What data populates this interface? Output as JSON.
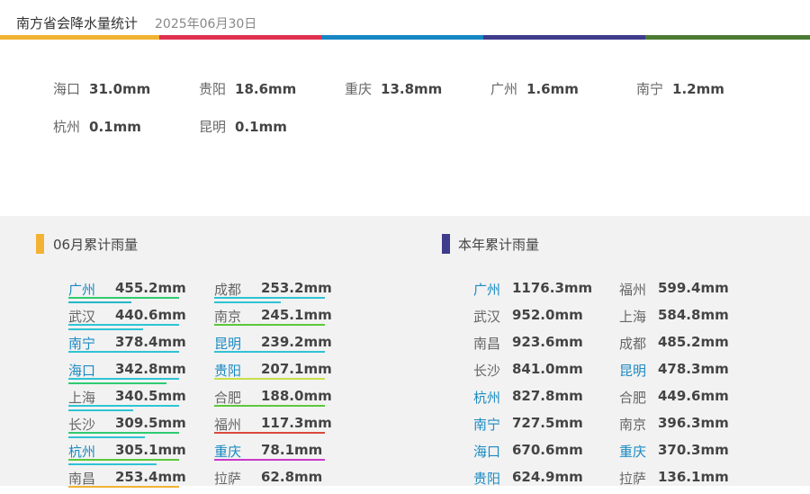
{
  "header": {
    "title": "南方省会降水量统计",
    "date": "2025年06月30日"
  },
  "colorbar": [
    "#f2b233",
    "#e0314f",
    "#1787c4",
    "#3f3c8c",
    "#4b7a33"
  ],
  "daily": [
    {
      "city": "海口",
      "value": "31.0mm"
    },
    {
      "city": "贵阳",
      "value": "18.6mm"
    },
    {
      "city": "重庆",
      "value": "13.8mm"
    },
    {
      "city": "广州",
      "value": "1.6mm"
    },
    {
      "city": "南宁",
      "value": "1.2mm"
    },
    {
      "city": "杭州",
      "value": "0.1mm"
    },
    {
      "city": "昆明",
      "value": "0.1mm"
    }
  ],
  "monthly": {
    "title": "06月累计雨量",
    "marker_color": "#f2b233",
    "items": [
      {
        "city": "广州",
        "value": "455.2mm",
        "highlight": true,
        "line_color": "#2ecc71",
        "line2_color": "#23b8c8"
      },
      {
        "city": "武汉",
        "value": "440.6mm",
        "highlight": false,
        "line_color": "#2fc3d4",
        "line2_color": "#2fc3d4"
      },
      {
        "city": "南宁",
        "value": "378.4mm",
        "highlight": true,
        "line_color": "#2fc3d4",
        "line2_color": ""
      },
      {
        "city": "海口",
        "value": "342.8mm",
        "highlight": true,
        "line_color": "#2fc3d4",
        "line2_color": "#2ecc71"
      },
      {
        "city": "上海",
        "value": "340.5mm",
        "highlight": false,
        "line_color": "#2fc3d4",
        "line2_color": "#2fc3d4"
      },
      {
        "city": "长沙",
        "value": "309.5mm",
        "highlight": false,
        "line_color": "#2ecc71",
        "line2_color": "#2fc3d4"
      },
      {
        "city": "杭州",
        "value": "305.1mm",
        "highlight": true,
        "line_color": "#5cc83a",
        "line2_color": "#2fc3d4"
      },
      {
        "city": "南昌",
        "value": "253.4mm",
        "highlight": false,
        "line_color": "#f2b233",
        "line2_color": ""
      },
      {
        "city": "成都",
        "value": "253.2mm",
        "highlight": false,
        "line_color": "#2fc3d4",
        "line2_color": "#2fc3d4"
      },
      {
        "city": "南京",
        "value": "245.1mm",
        "highlight": false,
        "line_color": "#5cc83a",
        "line2_color": ""
      },
      {
        "city": "昆明",
        "value": "239.2mm",
        "highlight": true,
        "line_color": "#2fc3d4",
        "line2_color": ""
      },
      {
        "city": "贵阳",
        "value": "207.1mm",
        "highlight": true,
        "line_color": "#c8e04a",
        "line2_color": ""
      },
      {
        "city": "合肥",
        "value": "188.0mm",
        "highlight": false,
        "line_color": "#5cc83a",
        "line2_color": ""
      },
      {
        "city": "福州",
        "value": "117.3mm",
        "highlight": false,
        "line_color": "#d94a3a",
        "line2_color": ""
      },
      {
        "city": "重庆",
        "value": "78.1mm",
        "highlight": true,
        "line_color": "#c83ac8",
        "line2_color": ""
      },
      {
        "city": "拉萨",
        "value": "62.8mm",
        "highlight": false,
        "line_color": "",
        "line2_color": ""
      }
    ]
  },
  "yearly": {
    "title": "本年累计雨量",
    "marker_color": "#3f3c8c",
    "items": [
      {
        "city": "广州",
        "value": "1176.3mm",
        "highlight": true
      },
      {
        "city": "武汉",
        "value": "952.0mm",
        "highlight": false
      },
      {
        "city": "南昌",
        "value": "923.6mm",
        "highlight": false
      },
      {
        "city": "长沙",
        "value": "841.0mm",
        "highlight": false
      },
      {
        "city": "杭州",
        "value": "827.8mm",
        "highlight": true
      },
      {
        "city": "南宁",
        "value": "727.5mm",
        "highlight": true
      },
      {
        "city": "海口",
        "value": "670.6mm",
        "highlight": true
      },
      {
        "city": "贵阳",
        "value": "624.9mm",
        "highlight": true
      },
      {
        "city": "福州",
        "value": "599.4mm",
        "highlight": false
      },
      {
        "city": "上海",
        "value": "584.8mm",
        "highlight": false
      },
      {
        "city": "成都",
        "value": "485.2mm",
        "highlight": false
      },
      {
        "city": "昆明",
        "value": "478.3mm",
        "highlight": true
      },
      {
        "city": "合肥",
        "value": "449.6mm",
        "highlight": false
      },
      {
        "city": "南京",
        "value": "396.3mm",
        "highlight": false
      },
      {
        "city": "重庆",
        "value": "370.3mm",
        "highlight": true
      },
      {
        "city": "拉萨",
        "value": "136.1mm",
        "highlight": false
      }
    ]
  }
}
